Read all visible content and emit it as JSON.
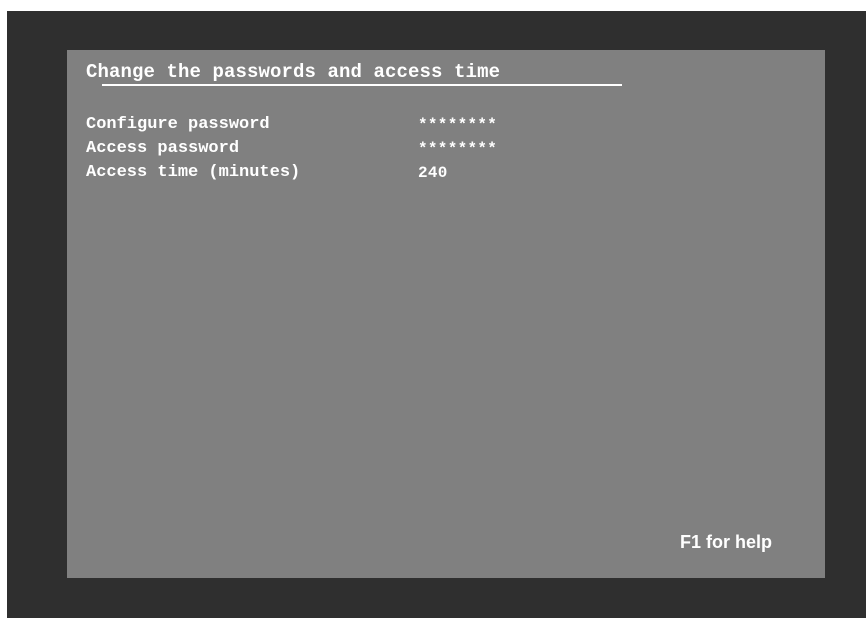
{
  "screen": {
    "title": "Change the passwords and access time",
    "help_text": "F1 for help"
  },
  "settings": [
    {
      "label": "Configure password",
      "value": "********"
    },
    {
      "label": "Access password",
      "value": "********"
    },
    {
      "label": "Access time (minutes)",
      "value": "240"
    }
  ],
  "colors": {
    "bezel": "#2f2f2f",
    "screen_background": "#808080",
    "text": "#ffffff"
  }
}
